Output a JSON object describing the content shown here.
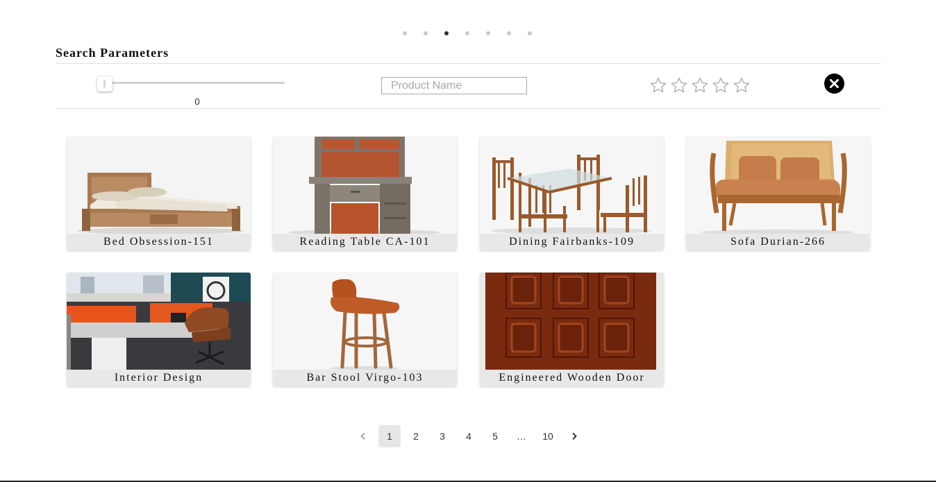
{
  "carousel": {
    "dot_count": 7,
    "active_index": 2
  },
  "search": {
    "title": "Search Parameters",
    "price_slider_value": "0",
    "product_name_placeholder": "Product Name",
    "rating_stars": 5,
    "rating_selected": 0
  },
  "products": [
    {
      "name": "Bed Obsession-151",
      "icon": "bed-image"
    },
    {
      "name": "Reading Table CA-101",
      "icon": "reading-table-image"
    },
    {
      "name": "Dining Fairbanks-109",
      "icon": "dining-set-image"
    },
    {
      "name": "Sofa Durian-266",
      "icon": "sofa-image"
    },
    {
      "name": "Interior Design",
      "icon": "office-interior-image"
    },
    {
      "name": "Bar Stool Virgo-103",
      "icon": "bar-stool-image"
    },
    {
      "name": "Engineered Wooden Door",
      "icon": "wooden-door-image"
    }
  ],
  "pagination": {
    "prev_icon": "chevron-left-icon",
    "pages": [
      "1",
      "2",
      "3",
      "4",
      "5",
      "…",
      "10"
    ],
    "active_page": "1",
    "next_icon": "chevron-right-icon"
  },
  "colors": {
    "caption_bg": "#e8e8e8",
    "wood": "#a0612f",
    "door": "#7a2a0f",
    "accent_orange": "#e4571e"
  }
}
